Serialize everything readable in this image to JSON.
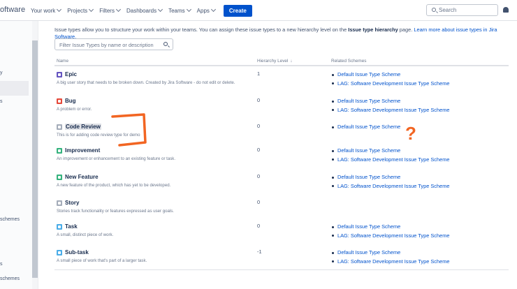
{
  "header": {
    "brand": "oftware",
    "nav": [
      {
        "label": "Your work"
      },
      {
        "label": "Projects"
      },
      {
        "label": "Filters"
      },
      {
        "label": "Dashboards"
      },
      {
        "label": "Teams"
      },
      {
        "label": "Apps"
      }
    ],
    "create_label": "Create",
    "search_placeholder": "Search"
  },
  "sidebar": {
    "fragments": [
      {
        "text": "y"
      },
      {
        "text": "s"
      },
      {
        "text": "schemes"
      },
      {
        "text": "s"
      },
      {
        "text": "schemes"
      }
    ]
  },
  "intro": {
    "text_a": "Issue types allow you to structure your work within your teams. You can assign these issue types to a new hierarchy level on the ",
    "bold": "Issue type hierarchy",
    "text_b": " page. ",
    "link": "Learn more about issue types in Jira Software."
  },
  "filter": {
    "placeholder": "Filter Issue Types by name or description"
  },
  "table": {
    "columns": {
      "name": "Name",
      "level": "Hierarchy Level",
      "sort": "↓",
      "schemes": "Related Schemes"
    },
    "rows": [
      {
        "name": "Epic",
        "icon": "epic-icon",
        "color": "#6554c0",
        "description": "A big user story that needs to be broken down. Created by Jira Software - do not edit or delete.",
        "level": "1",
        "schemes": [
          "Default Issue Type Scheme",
          "LAG: Software Development Issue Type Scheme"
        ]
      },
      {
        "name": "Bug",
        "icon": "bug-icon",
        "color": "#e5493a",
        "description": "A problem or error.",
        "level": "0",
        "schemes": [
          "Default Issue Type Scheme",
          "LAG: Software Development Issue Type Scheme"
        ]
      },
      {
        "name": "Code Review",
        "icon": "code-review-icon",
        "color": "#a5adba",
        "description": "This is for adding code review type for demo",
        "level": "0",
        "schemes": [
          "Default Issue Type Scheme"
        ]
      },
      {
        "name": "Improvement",
        "icon": "improvement-icon",
        "color": "#36b37e",
        "description": "An improvement or enhancement to an existing feature or task.",
        "level": "0",
        "schemes": [
          "Default Issue Type Scheme",
          "LAG: Software Development Issue Type Scheme"
        ]
      },
      {
        "name": "New Feature",
        "icon": "new-feature-icon",
        "color": "#36b37e",
        "description": "A new feature of the product, which has yet to be developed.",
        "level": "0",
        "schemes": [
          "Default Issue Type Scheme",
          "LAG: Software Development Issue Type Scheme"
        ]
      },
      {
        "name": "Story",
        "icon": "story-icon",
        "color": "#a5adba",
        "description": "Stories track functionality or features expressed as user goals.",
        "level": "0",
        "schemes": []
      },
      {
        "name": "Task",
        "icon": "task-icon",
        "color": "#4bade8",
        "description": "A small, distinct piece of work.",
        "level": "0",
        "schemes": [
          "Default Issue Type Scheme",
          "LAG: Software Development Issue Type Scheme"
        ]
      },
      {
        "name": "Sub-task",
        "icon": "subtask-icon",
        "color": "#4bade8",
        "description": "A small piece of work that's part of a larger task.",
        "level": "-1",
        "schemes": [
          "Default Issue Type Scheme",
          "LAG: Software Development Issue Type Scheme"
        ]
      }
    ]
  },
  "annotations": {
    "question_mark": "?"
  },
  "colors": {
    "primary": "#0052cc",
    "annotation": "#f26522"
  }
}
